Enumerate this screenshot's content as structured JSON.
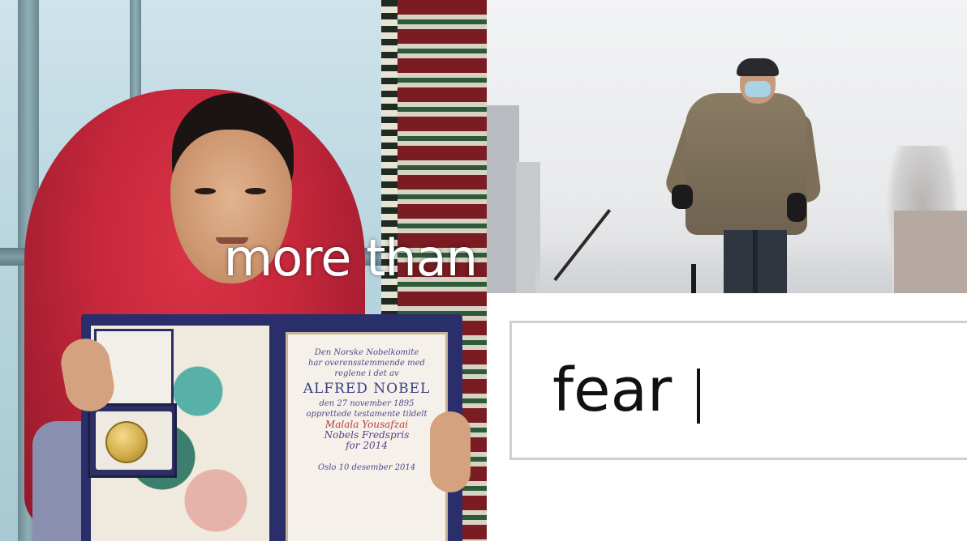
{
  "left_panel": {
    "caption": "more than",
    "certificate": {
      "line1": "Den Norske Nobelkomite",
      "line2": "har overensstemmende med",
      "line3": "reglene i det av",
      "name": "ALFRED NOBEL",
      "line4": "den 27 november 1895",
      "line5": "opprettede testamente tildelt",
      "laureate": "Malala Yousafzai",
      "prize": "Nobels Fredspris",
      "year": "for 2014",
      "footer": "Oslo 10 desember 2014"
    }
  },
  "right_panel": {
    "search_text": "fear"
  }
}
